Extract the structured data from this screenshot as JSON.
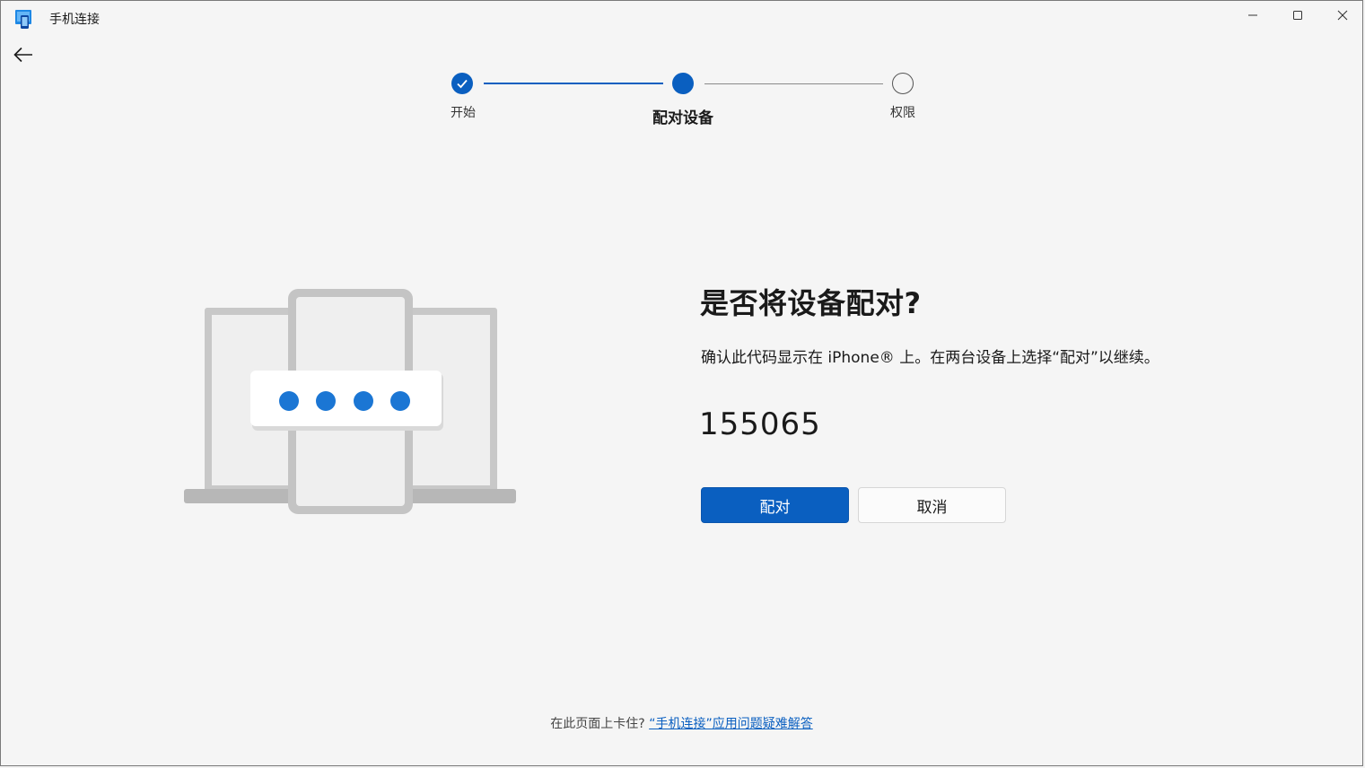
{
  "window": {
    "title": "手机连接",
    "icon": "phone-link-app-icon"
  },
  "stepper": {
    "steps": [
      {
        "label": "开始",
        "state": "completed"
      },
      {
        "label": "配对设备",
        "state": "current"
      },
      {
        "label": "权限",
        "state": "pending"
      }
    ]
  },
  "main": {
    "heading": "是否将设备配对?",
    "description": "确认此代码显示在 iPhone® 上。在两台设备上选择“配对”以继续。",
    "code": "155065",
    "pair_button": "配对",
    "cancel_button": "取消"
  },
  "footer": {
    "prompt": "在此页面上卡住? ",
    "link": "“手机连接”应用问题疑难解答"
  },
  "colors": {
    "accent": "#0a5fc0",
    "background": "#f5f5f5",
    "illustration_dots": "#1b76d4"
  }
}
